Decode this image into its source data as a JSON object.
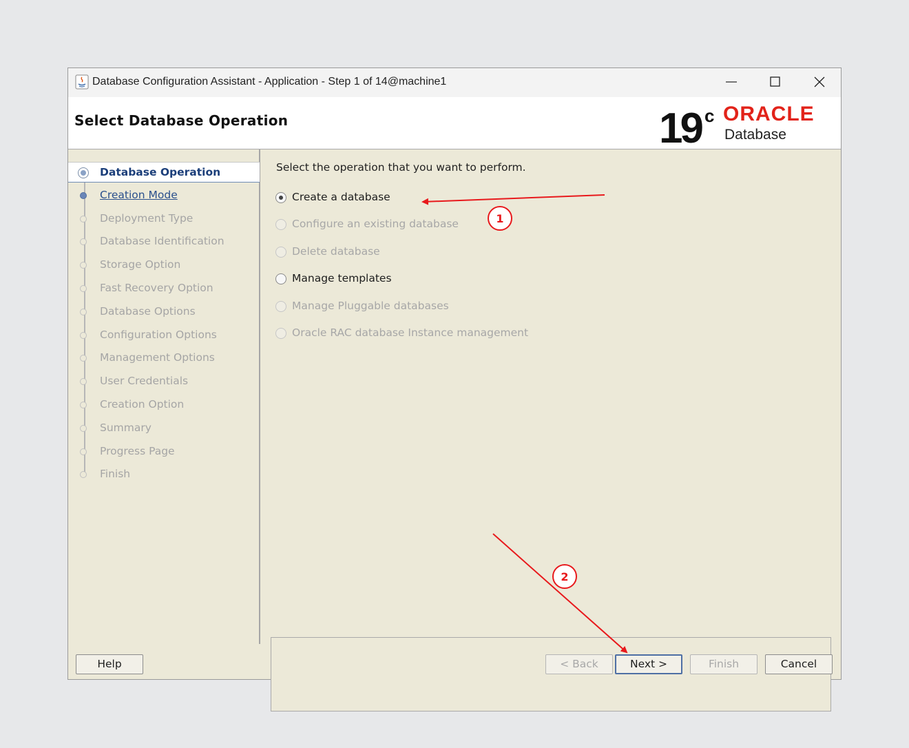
{
  "window": {
    "title": "Database Configuration Assistant - Application - Step 1 of 14@machine1"
  },
  "header": {
    "page_title": "Select Database Operation",
    "logo": {
      "version": "19",
      "superscript": "c",
      "brand": "ORACLE",
      "product": "Database",
      "brand_color": "#e2231a"
    }
  },
  "nav": {
    "items": [
      {
        "label": "Database Operation",
        "state": "current"
      },
      {
        "label": "Creation Mode",
        "state": "link"
      },
      {
        "label": "Deployment Type",
        "state": "disabled"
      },
      {
        "label": "Database Identification",
        "state": "disabled"
      },
      {
        "label": "Storage Option",
        "state": "disabled"
      },
      {
        "label": "Fast Recovery Option",
        "state": "disabled"
      },
      {
        "label": "Database Options",
        "state": "disabled"
      },
      {
        "label": "Configuration Options",
        "state": "disabled"
      },
      {
        "label": "Management Options",
        "state": "disabled"
      },
      {
        "label": "User Credentials",
        "state": "disabled"
      },
      {
        "label": "Creation Option",
        "state": "disabled"
      },
      {
        "label": "Summary",
        "state": "disabled"
      },
      {
        "label": "Progress Page",
        "state": "disabled"
      },
      {
        "label": "Finish",
        "state": "disabled"
      }
    ]
  },
  "main": {
    "instruction": "Select the operation that you want to perform.",
    "options": [
      {
        "label": "Create a database",
        "selected": true,
        "enabled": true
      },
      {
        "label": "Configure an existing database",
        "selected": false,
        "enabled": false
      },
      {
        "label": "Delete database",
        "selected": false,
        "enabled": false
      },
      {
        "label": "Manage templates",
        "selected": false,
        "enabled": true
      },
      {
        "label": "Manage Pluggable databases",
        "selected": false,
        "enabled": false
      },
      {
        "label": "Oracle RAC database Instance management",
        "selected": false,
        "enabled": false
      }
    ]
  },
  "buttons": {
    "help": "Help",
    "back": "< Back",
    "next": "Next >",
    "finish": "Finish",
    "cancel": "Cancel"
  },
  "annotations": {
    "color": "#e8191c",
    "markers": [
      "1",
      "2"
    ]
  }
}
